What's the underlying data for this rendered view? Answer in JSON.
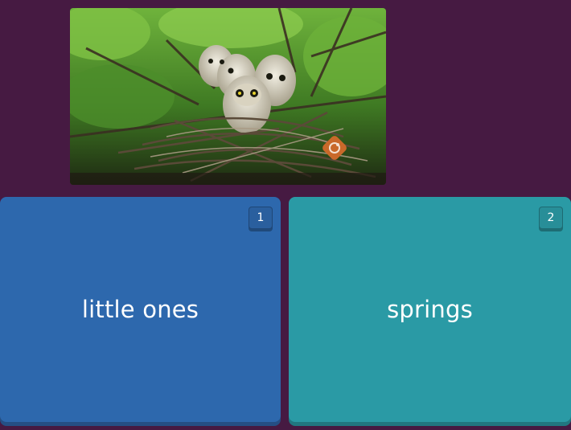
{
  "question": {
    "image_alt": "owl chicks in a nest"
  },
  "options": [
    {
      "key": "1",
      "label": "little ones",
      "color": "#2d68ad"
    },
    {
      "key": "2",
      "label": "springs",
      "color": "#2a9aa5"
    }
  ],
  "colors": {
    "background": "#461a42",
    "badge_logo": "#c9692a"
  }
}
